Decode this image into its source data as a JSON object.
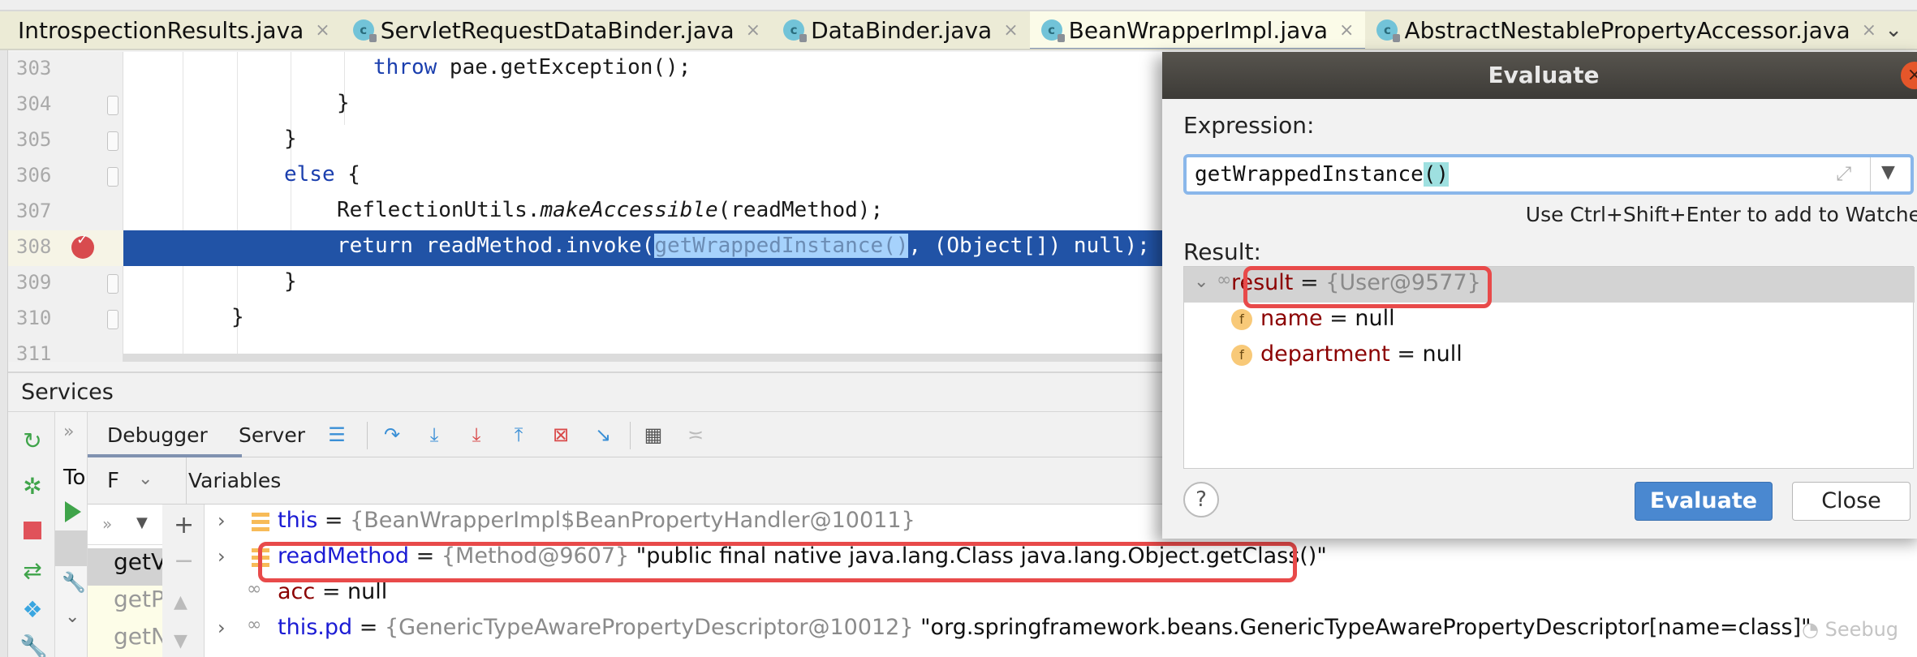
{
  "tabs": [
    {
      "label": "IntrospectionResults.java",
      "active": false,
      "has_icon": false
    },
    {
      "label": "ServletRequestDataBinder.java",
      "active": false,
      "has_icon": true
    },
    {
      "label": "DataBinder.java",
      "active": false,
      "has_icon": true
    },
    {
      "label": "BeanWrapperImpl.java",
      "active": true,
      "has_icon": true
    },
    {
      "label": "AbstractNestablePropertyAccessor.java",
      "active": false,
      "has_icon": true
    }
  ],
  "tab_icon_letter": "c",
  "tab_close_glyph": "×",
  "tab_overflow_glyph": "⌄",
  "editor": {
    "lines": [
      {
        "number": "303",
        "parts": [
          {
            "t": "throw",
            "c": "kw"
          },
          {
            "t": " pae.getException();"
          }
        ]
      },
      {
        "number": "304",
        "parts": [
          {
            "t": "}"
          }
        ]
      },
      {
        "number": "305",
        "parts": [
          {
            "t": "}"
          }
        ]
      },
      {
        "number": "306",
        "parts": [
          {
            "t": "else",
            "c": "kw"
          },
          {
            "t": " {"
          }
        ]
      },
      {
        "number": "307",
        "parts": [
          {
            "t": "ReflectionUtils."
          },
          {
            "t": "makeAccessible",
            "c": "it"
          },
          {
            "t": "(readMethod);"
          }
        ]
      },
      {
        "number": "308",
        "parts": [
          {
            "t": "return readMethod.invoke("
          },
          {
            "t": "getWrappedInstance()",
            "c": "hl"
          },
          {
            "t": ", (Object[]) null);"
          }
        ]
      },
      {
        "number": "309",
        "parts": [
          {
            "t": "}"
          }
        ]
      },
      {
        "number": "310",
        "parts": [
          {
            "t": "}"
          }
        ]
      },
      {
        "number": "311",
        "parts": []
      }
    ],
    "execution_line": "308",
    "breakpoint_line": "308"
  },
  "services": {
    "title": "Services",
    "tree_partial_label": "To",
    "debugger_tabs": {
      "debugger": "Debugger",
      "server": "Server"
    },
    "frames_header": "F",
    "frames": [
      {
        "label": "getV",
        "selected": true
      },
      {
        "label": "getP",
        "selected": false
      },
      {
        "label": "getN",
        "selected": false
      }
    ],
    "variables_title": "Variables",
    "variables": [
      {
        "name": "this",
        "eq": " = ",
        "type": "{BeanWrapperImpl$BeanPropertyHandler@10011}",
        "value": "",
        "expandable": true,
        "icon": "stack-frame-icon",
        "highlighted": false
      },
      {
        "name": "readMethod",
        "eq": " = ",
        "type": "{Method@9607}",
        "value": " \"public final native java.lang.Class java.lang.Object.getClass()\"",
        "expandable": true,
        "icon": "stack-frame-icon",
        "highlighted": true
      },
      {
        "name": "acc",
        "eq": " = ",
        "type": "",
        "value": "null",
        "expandable": false,
        "icon": "watch-icon",
        "highlighted": false
      },
      {
        "name": "this.pd",
        "eq": " = ",
        "type": "{GenericTypeAwarePropertyDescriptor@10012}",
        "value": " \"org.springframework.beans.GenericTypeAwarePropertyDescriptor[name=class]\"",
        "expandable": true,
        "icon": "watch-icon",
        "highlighted": false
      }
    ]
  },
  "evaluate_dialog": {
    "title": "Evaluate",
    "close_glyph": "×",
    "expression_label": "Expression:",
    "expression_value_main": "getWrappedInstance",
    "expression_value_parens": "()",
    "expand_glyph": "⤢",
    "dropdown_glyph": "▼",
    "hint": "Use Ctrl+Shift+Enter to add to Watches",
    "result_label": "Result:",
    "result": {
      "name": "result",
      "eq": " = ",
      "type": "{User@9577}",
      "expanded": true
    },
    "fields": [
      {
        "name": "name",
        "eq": " = ",
        "value": "null"
      },
      {
        "name": "department",
        "eq": " = ",
        "value": "null"
      }
    ],
    "field_icon_letter": "f",
    "help_label": "?",
    "evaluate_label": "Evaluate",
    "close_label": "Close"
  },
  "watermark": "Seebug",
  "colors": {
    "accent_blue": "#4a88d0",
    "execution_line": "#2153a6",
    "annotation_red": "#e84a4a",
    "breakpoint": "#d84b4e"
  }
}
